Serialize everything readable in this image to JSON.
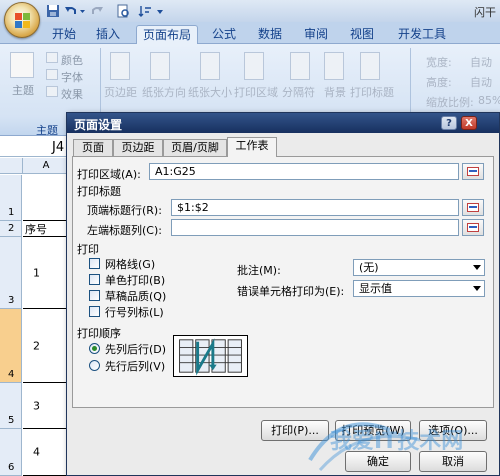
{
  "app": {
    "title": "闪干",
    "tabs": [
      "开始",
      "插入",
      "页面布局",
      "公式",
      "数据",
      "审阅",
      "视图",
      "开发工具"
    ],
    "active_tab": "页面布局"
  },
  "ribbon": {
    "theme_group_label": "主题",
    "theme_button": "主题",
    "colors": "颜色",
    "fonts": "字体",
    "effects": "效果",
    "page_setup": [
      "页边距",
      "纸张方向",
      "纸张大小",
      "打印区域",
      "分隔符",
      "背景",
      "打印标题"
    ],
    "width_label": "宽度:",
    "height_label": "高度:",
    "width_value": "自动",
    "height_value": "自动",
    "scale_label": "缩放比例:",
    "scale_value": "85%"
  },
  "sheet": {
    "formula_fragment": "J4",
    "col_a": "A",
    "rows": [
      {
        "num": "1",
        "value": ""
      },
      {
        "num": "2",
        "value": "序号"
      },
      {
        "num": "3",
        "value": "1"
      },
      {
        "num": "4",
        "value": "2"
      },
      {
        "num": "5",
        "value": "3"
      },
      {
        "num": "6",
        "value": "4"
      }
    ]
  },
  "dialog": {
    "title": "页面设置",
    "help": "?",
    "close": "X",
    "tabs": [
      "页面",
      "页边距",
      "页眉/页脚",
      "工作表"
    ],
    "active_tab": "工作表",
    "print_area_label": "打印区域(A):",
    "print_area_value": "A1:G25",
    "print_titles_label": "打印标题",
    "top_rows_label": "顶端标题行(R):",
    "top_rows_value": "$1:$2",
    "left_cols_label": "左端标题列(C):",
    "left_cols_value": "",
    "print_section_label": "打印",
    "checkboxes": [
      "网格线(G)",
      "单色打印(B)",
      "草稿品质(Q)",
      "行号列标(L)"
    ],
    "comments_label": "批注(M):",
    "comments_value": "(无)",
    "errors_label": "错误单元格打印为(E):",
    "errors_value": "显示值",
    "order_label": "打印顺序",
    "order_options": [
      "先列后行(D)",
      "先行后列(V)"
    ],
    "selected_order": "先列后行(D)",
    "buttons": {
      "print": "打印(P)...",
      "preview": "打印预览(W)",
      "options": "选项(O)...",
      "ok": "确定",
      "cancel": "取消"
    }
  },
  "watermark": "我爱IT技术网"
}
